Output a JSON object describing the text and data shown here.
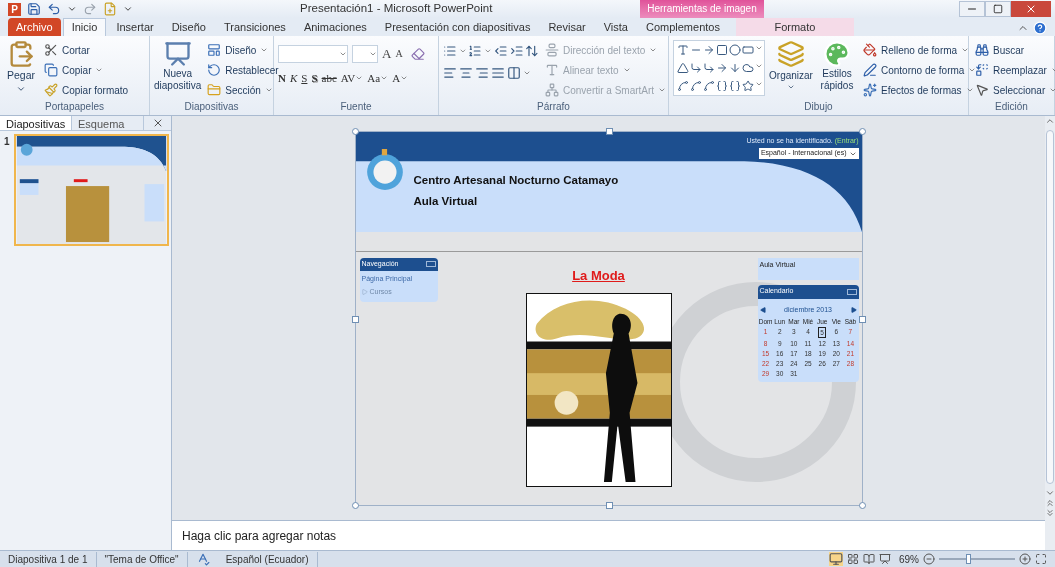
{
  "title_bar": {
    "app_icon": "P",
    "title": "Presentación1  -  Microsoft PowerPoint",
    "contextual_group": "Herramientas de imagen"
  },
  "tabs": [
    {
      "label": "Archivo",
      "kind": "file",
      "selected": false
    },
    {
      "label": "Inicio",
      "kind": "normal",
      "selected": true
    },
    {
      "label": "Insertar",
      "kind": "normal",
      "selected": false
    },
    {
      "label": "Diseño",
      "kind": "normal",
      "selected": false
    },
    {
      "label": "Transiciones",
      "kind": "normal",
      "selected": false
    },
    {
      "label": "Animaciones",
      "kind": "normal",
      "selected": false
    },
    {
      "label": "Presentación con diapositivas",
      "kind": "normal",
      "selected": false
    },
    {
      "label": "Revisar",
      "kind": "normal",
      "selected": false
    },
    {
      "label": "Vista",
      "kind": "normal",
      "selected": false
    },
    {
      "label": "Complementos",
      "kind": "normal",
      "selected": false
    },
    {
      "label": "Formato",
      "kind": "contextual",
      "selected": false
    }
  ],
  "ribbon": {
    "clipboard": {
      "label": "Portapapeles",
      "paste": "Pegar",
      "items": [
        {
          "label": "Cortar",
          "dropdown": false
        },
        {
          "label": "Copiar",
          "dropdown": true
        },
        {
          "label": "Copiar formato",
          "dropdown": false
        }
      ]
    },
    "slides": {
      "label": "Diapositivas",
      "new_slide": "Nueva diapositiva",
      "items": [
        {
          "label": "Diseño",
          "dropdown": true
        },
        {
          "label": "Restablecer",
          "dropdown": false
        },
        {
          "label": "Sección",
          "dropdown": true
        }
      ]
    },
    "font": {
      "label": "Fuente",
      "size_buttons": [
        {
          "label": "A",
          "kind": "grow"
        },
        {
          "label": "A",
          "kind": "shrink"
        }
      ],
      "format_buttons": [
        {
          "label": "N",
          "kind": "bold",
          "dropdown": false
        },
        {
          "label": "K",
          "kind": "italic",
          "dropdown": false
        },
        {
          "label": "S",
          "kind": "underline",
          "dropdown": false
        },
        {
          "label": "S",
          "kind": "shadow",
          "dropdown": false
        },
        {
          "label": "abc",
          "kind": "strike",
          "dropdown": false
        },
        {
          "label": "AV",
          "kind": "spacing",
          "dropdown": true
        },
        {
          "label": "Aa",
          "kind": "case",
          "dropdown": true
        },
        {
          "label": "A",
          "kind": "color",
          "dropdown": true
        }
      ]
    },
    "paragraph": {
      "label": "Párrafo",
      "items": [
        {
          "label": "Dirección del texto",
          "disabled": true,
          "dropdown": true
        },
        {
          "label": "Alinear texto",
          "disabled": true,
          "dropdown": true
        },
        {
          "label": "Convertir a SmartArt",
          "disabled": true,
          "dropdown": true
        }
      ]
    },
    "drawing": {
      "label": "Dibujo",
      "arrange": "Organizar",
      "quick_styles": "Estilos rápidos",
      "items": [
        {
          "label": "Relleno de forma",
          "dropdown": true
        },
        {
          "label": "Contorno de forma",
          "dropdown": true
        },
        {
          "label": "Efectos de formas",
          "dropdown": true
        }
      ]
    },
    "editing": {
      "label": "Edición",
      "items": [
        {
          "label": "Buscar",
          "dropdown": false
        },
        {
          "label": "Reemplazar",
          "dropdown": true
        },
        {
          "label": "Seleccionar",
          "dropdown": true
        }
      ]
    }
  },
  "side_panel": {
    "tabs": [
      {
        "label": "Diapositivas",
        "selected": true
      },
      {
        "label": "Esquema",
        "selected": false
      }
    ],
    "slides": [
      {
        "number": "1",
        "selected": true
      }
    ]
  },
  "slide": {
    "login_text": "Usted no se ha identificado. ",
    "login_link": "(Entrar)",
    "language": "Español - Internacional (es)",
    "site_title": "Centro Artesanal Nocturno Catamayo",
    "site_subtitle": "Aula Virtual",
    "nav_block": {
      "title": "Navegación",
      "items": [
        {
          "label": "Página Principal",
          "expandable": false
        },
        {
          "label": "Cursos",
          "expandable": true
        }
      ]
    },
    "heading": "La Moda",
    "side_block": "Aula Virtual",
    "calendar": {
      "title": "Calendario",
      "month": "diciembre 2013",
      "weekdays": [
        "Dom",
        "Lun",
        "Mar",
        "Mié",
        "Jue",
        "Vie",
        "Sáb"
      ],
      "weeks": [
        [
          {
            "day": "1",
            "selected": false
          },
          {
            "day": "2",
            "selected": false
          },
          {
            "day": "3",
            "selected": false
          },
          {
            "day": "4",
            "selected": false
          },
          {
            "day": "5",
            "selected": true
          },
          {
            "day": "6",
            "selected": false
          },
          {
            "day": "7",
            "selected": false
          }
        ],
        [
          {
            "day": "8",
            "selected": false
          },
          {
            "day": "9",
            "selected": false
          },
          {
            "day": "10",
            "selected": false
          },
          {
            "day": "11",
            "selected": false
          },
          {
            "day": "12",
            "selected": false
          },
          {
            "day": "13",
            "selected": false
          },
          {
            "day": "14",
            "selected": false
          }
        ],
        [
          {
            "day": "15",
            "selected": false
          },
          {
            "day": "16",
            "selected": false
          },
          {
            "day": "17",
            "selected": false
          },
          {
            "day": "18",
            "selected": false
          },
          {
            "day": "19",
            "selected": false
          },
          {
            "day": "20",
            "selected": false
          },
          {
            "day": "21",
            "selected": false
          }
        ],
        [
          {
            "day": "22",
            "selected": false
          },
          {
            "day": "23",
            "selected": false
          },
          {
            "day": "24",
            "selected": false
          },
          {
            "day": "25",
            "selected": false
          },
          {
            "day": "26",
            "selected": false
          },
          {
            "day": "27",
            "selected": false
          },
          {
            "day": "28",
            "selected": false
          }
        ],
        [
          {
            "day": "29",
            "selected": false
          },
          {
            "day": "30",
            "selected": false
          },
          {
            "day": "31",
            "selected": false
          }
        ]
      ]
    }
  },
  "notes": {
    "placeholder": "Haga clic para agregar notas"
  },
  "status_bar": {
    "slide_info": "Diapositiva 1 de 1",
    "theme": "\"Tema de Office\"",
    "language": "Español (Ecuador)",
    "zoom": {
      "label": "69%",
      "level": 0.38
    }
  }
}
